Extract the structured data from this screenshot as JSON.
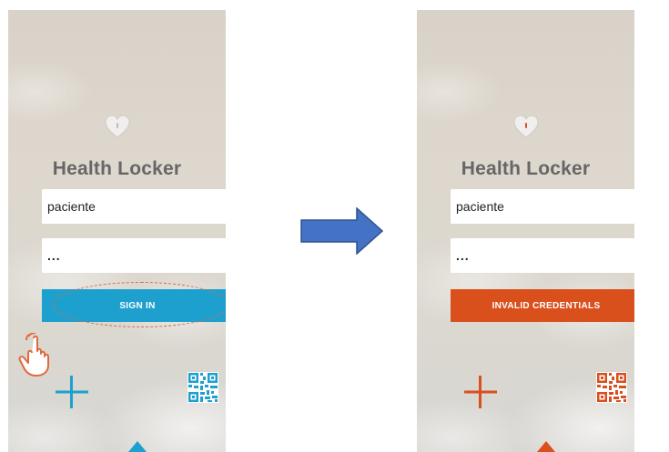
{
  "screens": [
    {
      "state": "before",
      "app_title": "Health Locker",
      "username_value": "paciente",
      "password_value": "...",
      "button_label": "SIGN IN",
      "button_color": "#1ea0cf",
      "accent_color": "#1ea0cf",
      "heart_mark_color": "#bbbbbb"
    },
    {
      "state": "after",
      "app_title": "Health Locker",
      "username_value": "paciente",
      "password_value": "...",
      "button_label": "INVALID CREDENTIALS",
      "button_color": "#d9501d",
      "accent_color": "#d9501d",
      "heart_mark_color": "#d9501d"
    }
  ],
  "icons": {
    "logo": "heart-icon",
    "add": "plus-icon",
    "scan": "qr-code-icon",
    "expand": "chevron-up-icon",
    "tap_hint": "tap-hand-icon",
    "transition": "right-arrow-icon"
  },
  "colors": {
    "transition_arrow": "#4472c4",
    "tap_hand": "#e06a3f"
  }
}
